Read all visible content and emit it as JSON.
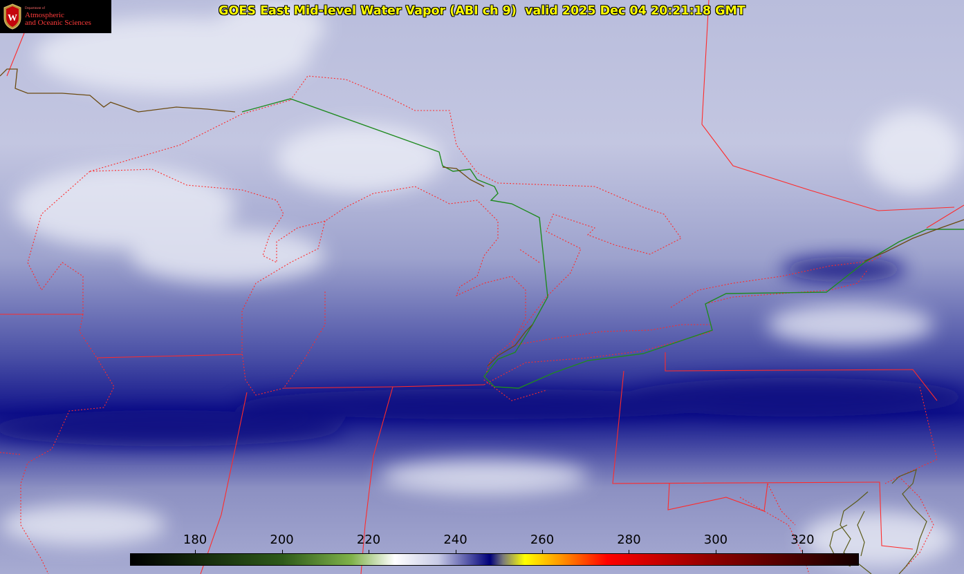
{
  "title": "GOES East Mid-level Water Vapor (ABI ch 9)  valid 2025 Dec 04 20:21:18 GMT",
  "logo": {
    "dept": "Department of",
    "line1": "Atmospheric",
    "line2": "and Oceanic Sciences",
    "crest_letter": "W"
  },
  "colorbar": {
    "labels": [
      "180",
      "200",
      "220",
      "240",
      "260",
      "280",
      "300",
      "320"
    ],
    "min": 165,
    "max": 333,
    "stops": [
      {
        "value": 165,
        "color": "#000000"
      },
      {
        "value": 200,
        "color": "#2e5a1a"
      },
      {
        "value": 216,
        "color": "#7fb24a"
      },
      {
        "value": 226,
        "color": "#ffffff"
      },
      {
        "value": 236,
        "color": "#c8cbe6"
      },
      {
        "value": 248,
        "color": "#00007a"
      },
      {
        "value": 251,
        "color": "#7a7a7a"
      },
      {
        "value": 256,
        "color": "#ffff00"
      },
      {
        "value": 265,
        "color": "#ff8c00"
      },
      {
        "value": 275,
        "color": "#ff0000"
      },
      {
        "value": 300,
        "color": "#8b0000"
      },
      {
        "value": 333,
        "color": "#140000"
      }
    ]
  },
  "colors": {
    "border": "#ff2a2a",
    "coast": "#1f8a1f",
    "shore": "#5a5a18",
    "moist": "#00006e",
    "mid": "#8f94c4",
    "dry": "#e8e8f2"
  }
}
